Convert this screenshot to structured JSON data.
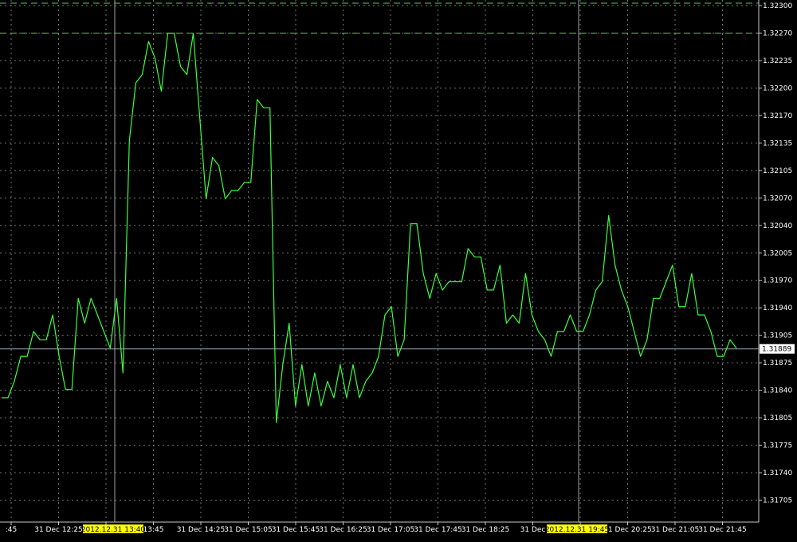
{
  "chart_data": {
    "type": "line",
    "colors": {
      "background": "#000000",
      "grid": "#6e7a6e",
      "axis": "#c8c8c8",
      "series": "#3cff3c",
      "level": "#55cc55",
      "current_line": "#9aa4b4",
      "highlight_bg": "#ffff00",
      "label_text": "#ffffff",
      "current_label_bg": "#ffffff",
      "current_label_text": "#000000"
    },
    "grid": true,
    "ylim": [
      1.3168,
      1.3231
    ],
    "y_ticks": [
      "1.32300",
      "1.32270",
      "1.32235",
      "1.32200",
      "1.32170",
      "1.32135",
      "1.32105",
      "1.32070",
      "1.32040",
      "1.32005",
      "1.31970",
      "1.31940",
      "1.31905",
      "1.31875",
      "1.31840",
      "1.31805",
      "1.31775",
      "1.31740",
      "1.31705"
    ],
    "x_ticks": [
      ":45",
      "31 Dec 12:25",
      "31 D",
      "13:45",
      "31 Dec 14:25",
      "31 Dec 15:05",
      "31 Dec 15:45",
      "31 Dec 16:25",
      "31 Dec 17:05",
      "31 Dec 17:45",
      "31 Dec 18:25",
      "31 Dec",
      "5",
      "31 Dec 20:25",
      "31 Dec 21:05",
      "31 Dec 21:45"
    ],
    "highlight_labels": [
      "2012.12.31 13:40",
      "2012.12.31 19:45"
    ],
    "current_price": "1.31889",
    "current_value": 1.31889,
    "level_value": 1.3227,
    "series": [
      {
        "values": [
          1.3183,
          1.3183,
          1.3185,
          1.3188,
          1.3188,
          1.3191,
          1.319,
          1.319,
          1.3193,
          1.3188,
          1.3184,
          1.3184,
          1.3195,
          1.3192,
          1.3195,
          1.3193,
          1.3191,
          1.3189,
          1.3195,
          1.3186,
          1.3214,
          1.3221,
          1.3222,
          1.3226,
          1.3224,
          1.322,
          1.3227,
          1.3227,
          1.3223,
          1.3222,
          1.3227,
          1.3217,
          1.3207,
          1.3212,
          1.3211,
          1.3207,
          1.3208,
          1.3208,
          1.3209,
          1.3209,
          1.3219,
          1.3218,
          1.3218,
          1.318,
          1.3187,
          1.3192,
          1.3182,
          1.3187,
          1.3182,
          1.3186,
          1.3182,
          1.3185,
          1.3183,
          1.3187,
          1.3183,
          1.3187,
          1.3183,
          1.3185,
          1.3186,
          1.3188,
          1.3193,
          1.3194,
          1.3188,
          1.319,
          1.3204,
          1.3204,
          1.3198,
          1.3195,
          1.3198,
          1.3196,
          1.3197,
          1.3197,
          1.3197,
          1.3201,
          1.32,
          1.32,
          1.3196,
          1.3196,
          1.3199,
          1.3192,
          1.3193,
          1.3192,
          1.3198,
          1.3193,
          1.3191,
          1.319,
          1.3188,
          1.3191,
          1.3191,
          1.3193,
          1.3191,
          1.3191,
          1.3193,
          1.3196,
          1.3197,
          1.3205,
          1.3199,
          1.3196,
          1.3194,
          1.3191,
          1.3188,
          1.319,
          1.3195,
          1.3195,
          1.3197,
          1.3199,
          1.3194,
          1.3194,
          1.3198,
          1.3193,
          1.3193,
          1.3191,
          1.3188,
          1.3188,
          1.319,
          1.3189
        ]
      }
    ]
  }
}
